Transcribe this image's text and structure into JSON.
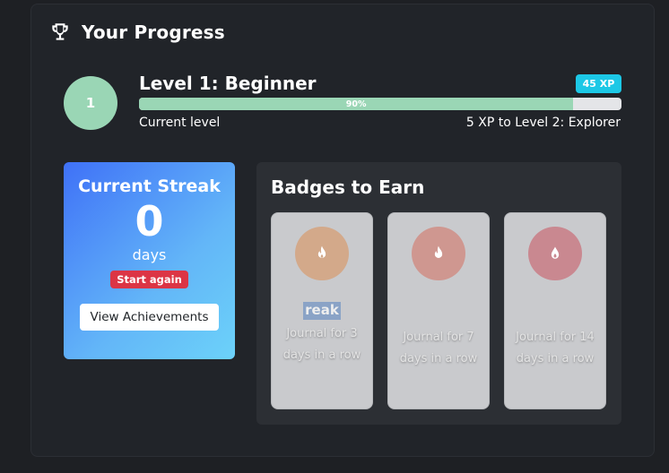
{
  "header": {
    "title": "Your Progress",
    "icon": "trophy-icon"
  },
  "level": {
    "number": "1",
    "title": "Level 1: Beginner",
    "xp_badge": "45 XP",
    "progress_label": "90%",
    "progress_fraction": 0.9,
    "current_label": "Current level",
    "next_label": "5 XP to Level 2: Explorer",
    "color": "#9ad6b5"
  },
  "streak": {
    "title": "Current Streak",
    "count": "0",
    "unit": "days",
    "status": "Start again",
    "button": "View Achievements"
  },
  "badges": {
    "title": "Badges to Earn",
    "items": [
      {
        "name": "reak",
        "description": "Journal for 3 days in a row",
        "icon": "fire-icon",
        "color": "#d3a98a"
      },
      {
        "name": "",
        "description": "Journal for 7 days in a row",
        "icon": "fire-icon",
        "color": "#cf9790"
      },
      {
        "name": "",
        "description": "Journal for 14 days in a row",
        "icon": "fire-icon",
        "color": "#c98890"
      }
    ]
  }
}
